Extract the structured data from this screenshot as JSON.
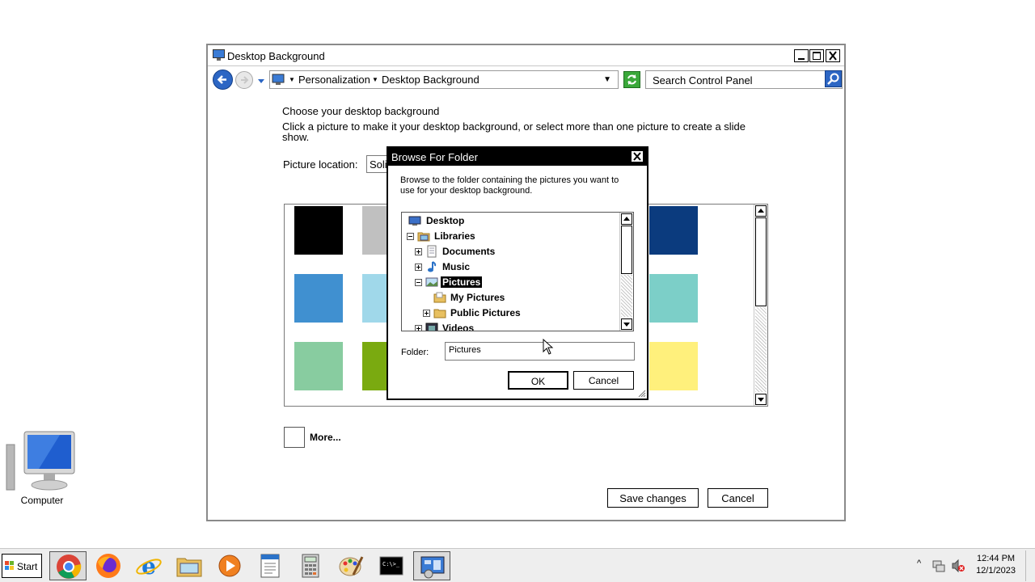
{
  "desktop": {
    "computer_icon_label": "Computer"
  },
  "window": {
    "title": "Desktop Background",
    "breadcrumb": [
      "Personalization",
      "Desktop Background"
    ],
    "search_placeholder": "Search Control Panel",
    "heading": "Choose your desktop background",
    "instructions": "Click a picture to make it your desktop background, or select more than one picture to create a slide show.",
    "picture_location_label": "Picture location:",
    "picture_location_value": "Soli",
    "swatches": [
      {
        "color": "#000000"
      },
      {
        "color": "#c0c0c0"
      },
      {
        "color": "#0b3b7e"
      },
      {
        "color": "#4090d0"
      },
      {
        "color": "#a0d8ea"
      },
      {
        "color": "#7ccfc8"
      },
      {
        "color": "#88cca0"
      },
      {
        "color": "#7aaa10"
      },
      {
        "color": "#fff07c"
      }
    ],
    "more_label": "More...",
    "save_button": "Save changes",
    "cancel_button": "Cancel"
  },
  "browse_dialog": {
    "title": "Browse For Folder",
    "instructions": "Browse to the folder containing the pictures you want to use for your desktop background.",
    "tree": [
      {
        "label": "Desktop",
        "icon": "desktop-icon",
        "expander": ""
      },
      {
        "label": "Libraries",
        "icon": "libraries-icon",
        "expander": "−"
      },
      {
        "label": "Documents",
        "icon": "documents-icon",
        "expander": "+"
      },
      {
        "label": "Music",
        "icon": "music-icon",
        "expander": "+"
      },
      {
        "label": "Pictures",
        "icon": "pictures-icon",
        "expander": "−",
        "selected": true
      },
      {
        "label": "My Pictures",
        "icon": "folder-icon",
        "expander": ""
      },
      {
        "label": "Public Pictures",
        "icon": "folder-icon",
        "expander": "+"
      },
      {
        "label": "Videos",
        "icon": "videos-icon",
        "expander": "+"
      }
    ],
    "folder_label": "Folder:",
    "folder_value": "Pictures",
    "ok_button": "OK",
    "cancel_button": "Cancel"
  },
  "taskbar": {
    "start_label": "Start",
    "pinned": [
      "chrome-icon",
      "firefox-icon",
      "internet-explorer-icon",
      "file-explorer-icon",
      "media-player-icon",
      "wordpad-icon",
      "calculator-icon",
      "paint-icon",
      "command-prompt-icon",
      "control-panel-icon"
    ],
    "active_item": "control-panel-icon",
    "clock_time": "12:44 PM",
    "clock_date": "12/1/2023"
  }
}
